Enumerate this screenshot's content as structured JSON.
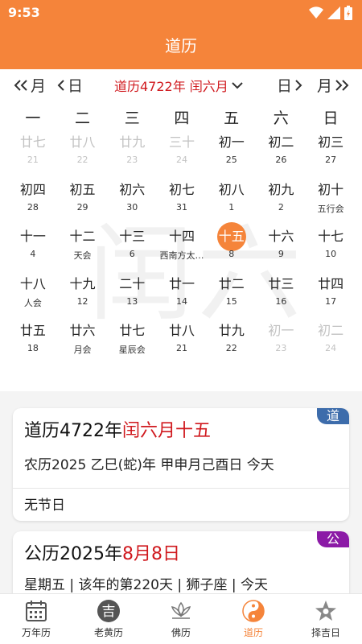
{
  "status": {
    "time": "9:53"
  },
  "app": {
    "title": "道历"
  },
  "nav": {
    "prev_month": "月",
    "prev_day": "日",
    "title": "道历4722年 闰六月",
    "next_day": "日",
    "next_month": "月"
  },
  "watermark": "闰六",
  "weekdays": [
    "一",
    "二",
    "三",
    "四",
    "五",
    "六",
    "日"
  ],
  "days": [
    {
      "lunar": "廿七",
      "sub": "21",
      "dim": true
    },
    {
      "lunar": "廿八",
      "sub": "22",
      "dim": true
    },
    {
      "lunar": "廿九",
      "sub": "23",
      "dim": true
    },
    {
      "lunar": "三十",
      "sub": "24",
      "dim": true
    },
    {
      "lunar": "初一",
      "sub": "25"
    },
    {
      "lunar": "初二",
      "sub": "26"
    },
    {
      "lunar": "初三",
      "sub": "27"
    },
    {
      "lunar": "初四",
      "sub": "28"
    },
    {
      "lunar": "初五",
      "sub": "29"
    },
    {
      "lunar": "初六",
      "sub": "30"
    },
    {
      "lunar": "初七",
      "sub": "31"
    },
    {
      "lunar": "初八",
      "sub": "1"
    },
    {
      "lunar": "初九",
      "sub": "2"
    },
    {
      "lunar": "初十",
      "sub": "五行会"
    },
    {
      "lunar": "十一",
      "sub": "4"
    },
    {
      "lunar": "十二",
      "sub": "天会"
    },
    {
      "lunar": "十三",
      "sub": "6"
    },
    {
      "lunar": "十四",
      "sub": "西南方太…"
    },
    {
      "lunar": "十五",
      "sub": "8",
      "today": true
    },
    {
      "lunar": "十六",
      "sub": "9"
    },
    {
      "lunar": "十七",
      "sub": "10"
    },
    {
      "lunar": "十八",
      "sub": "人会"
    },
    {
      "lunar": "十九",
      "sub": "12"
    },
    {
      "lunar": "二十",
      "sub": "13"
    },
    {
      "lunar": "廿一",
      "sub": "14"
    },
    {
      "lunar": "廿二",
      "sub": "15"
    },
    {
      "lunar": "廿三",
      "sub": "16"
    },
    {
      "lunar": "廿四",
      "sub": "17"
    },
    {
      "lunar": "廿五",
      "sub": "18"
    },
    {
      "lunar": "廿六",
      "sub": "月会"
    },
    {
      "lunar": "廿七",
      "sub": "星辰会"
    },
    {
      "lunar": "廿八",
      "sub": "21"
    },
    {
      "lunar": "廿九",
      "sub": "22"
    },
    {
      "lunar": "初一",
      "sub": "23",
      "dim": true
    },
    {
      "lunar": "初二",
      "sub": "24",
      "dim": true
    }
  ],
  "card_dao": {
    "tag": "道",
    "title_prefix": "道历4722年",
    "title_highlight": "闰六月十五",
    "line1": "农历2025 乙巳(蛇)年 甲申月己酉日 今天",
    "festival": "无节日"
  },
  "card_gong": {
    "tag": "公",
    "title_prefix": "公历2025年",
    "title_highlight": "8月8日",
    "line1": "星期五 | 该年的第220天 | 狮子座 | 今天"
  },
  "tabs": [
    {
      "label": "万年历",
      "icon": "calendar-grid-icon"
    },
    {
      "label": "老黄历",
      "icon": "ji-circle-icon"
    },
    {
      "label": "佛历",
      "icon": "lotus-icon"
    },
    {
      "label": "道历",
      "icon": "yin-yang-icon",
      "active": true
    },
    {
      "label": "择吉日",
      "icon": "star-icon"
    }
  ],
  "colors": {
    "accent": "#f5843a",
    "red": "#d0191e",
    "tag_dao": "#3d6cab",
    "tag_gong": "#8b1aa6"
  }
}
